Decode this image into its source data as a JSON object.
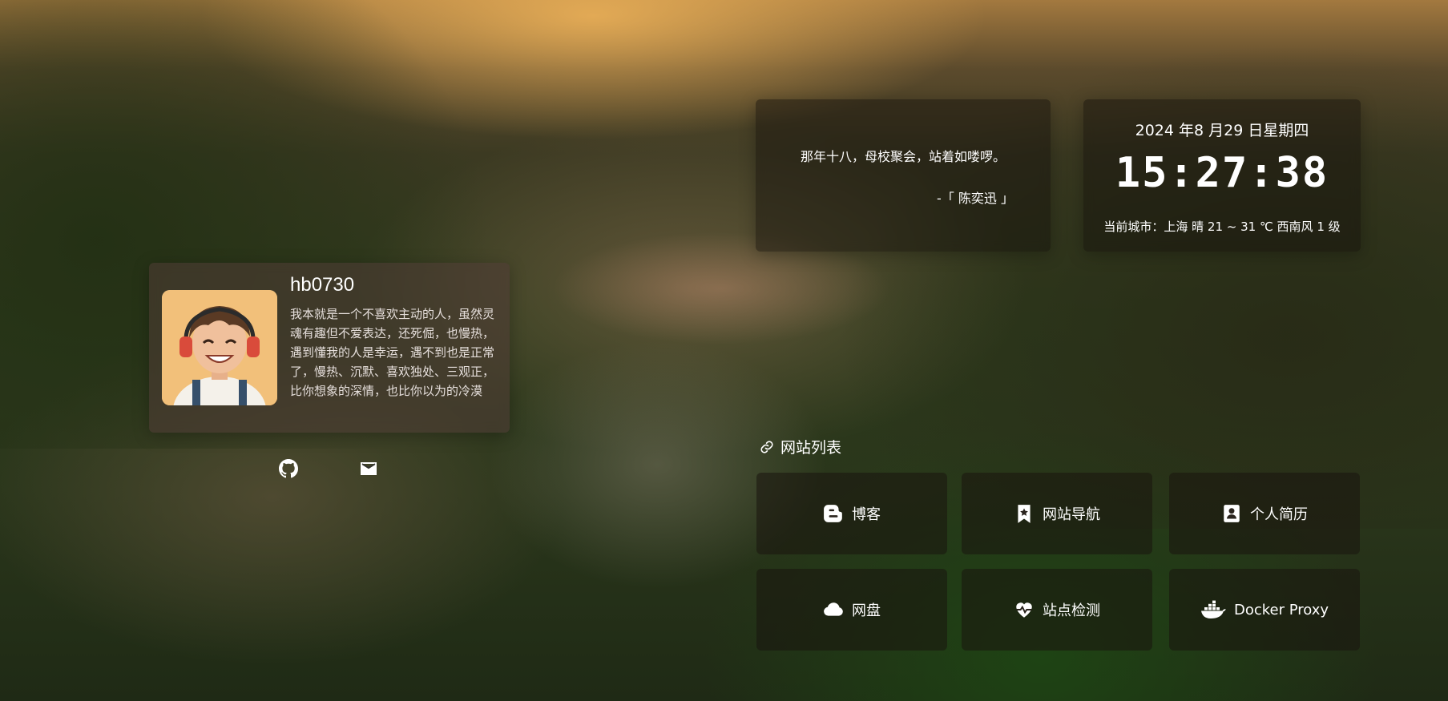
{
  "profile": {
    "username": "hb0730",
    "bio": "我本就是一个不喜欢主动的人，虽然灵魂有趣但不爱表达，还死倔，也慢热，遇到懂我的人是幸运，遇不到也是正常了，慢热、沉默、喜欢独处、三观正，比你想象的深情，也比你以为的冷漠",
    "social": [
      "github-icon",
      "mail-icon"
    ]
  },
  "quote": {
    "text": "那年十八，母校聚会，站着如喽啰。",
    "from": "-「 陈奕迅 」"
  },
  "clock": {
    "date": "2024 年8 月29 日星期四",
    "time": "15:27:38",
    "weather": "当前城市：上海 晴 21 ~ 31 ℃ 西南风 1 级"
  },
  "sites": {
    "title": "网站列表",
    "items": [
      {
        "label": "博客",
        "icon": "blogger-icon"
      },
      {
        "label": "网站导航",
        "icon": "bookmark-star-icon"
      },
      {
        "label": "个人简历",
        "icon": "resume-icon"
      },
      {
        "label": "网盘",
        "icon": "cloud-icon"
      },
      {
        "label": "站点检测",
        "icon": "heartbeat-icon"
      },
      {
        "label": "Docker Proxy",
        "icon": "docker-icon"
      }
    ]
  }
}
